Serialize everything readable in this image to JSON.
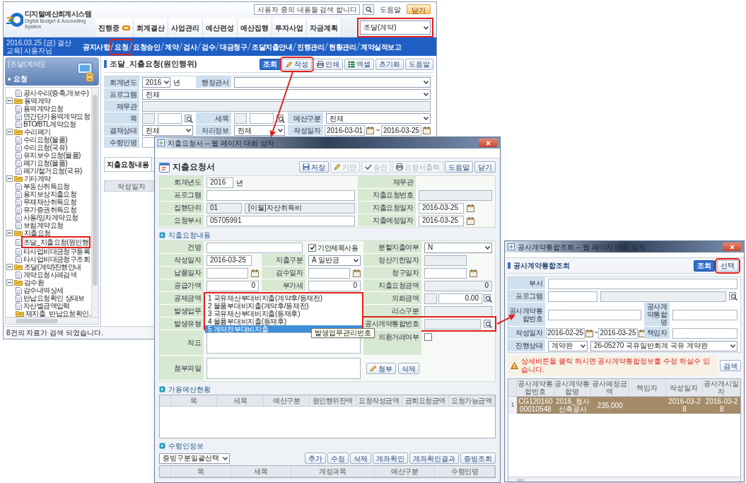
{
  "main_window": {
    "logo": {
      "name": "디지털예산회계시스템",
      "tagline": "Digital Budget & Accounting System"
    },
    "search": {
      "placeholder": "사용자 중의 내용을 검색 합니다"
    },
    "links": [
      {
        "label": "도움말",
        "kind": "link"
      },
      {
        "label": "닫기",
        "kind": "button"
      }
    ],
    "top_menu": [
      {
        "label": "진행중",
        "badge": true
      },
      {
        "label": "회계결산",
        "badge": false
      },
      {
        "label": "사업관리",
        "badge": false
      },
      {
        "label": "예산편성",
        "badge": false
      },
      {
        "label": "예산집행",
        "badge": false
      },
      {
        "label": "투자사업",
        "badge": false
      },
      {
        "label": "자금계획",
        "badge": false
      }
    ],
    "work_select": {
      "value": "조달(계약)",
      "highlighted": true
    },
    "user_info": "2016.03.25 (금) 결산교육| 사용자님",
    "sub_menu": [
      {
        "label": "공지사항",
        "selected": false
      },
      {
        "label": "요청",
        "selected": true
      },
      {
        "label": "요청승인",
        "selected": false
      },
      {
        "label": "계약",
        "selected": false
      },
      {
        "label": "검사",
        "selected": false
      },
      {
        "label": "검수",
        "selected": false
      },
      {
        "label": "대금청구",
        "selected": false
      },
      {
        "label": "조달지출안내",
        "selected": false
      },
      {
        "label": "진행관리",
        "selected": false
      },
      {
        "label": "현황관리",
        "selected": false
      },
      {
        "label": "계약실적보고",
        "selected": false
      }
    ],
    "sidebar": {
      "category": "[조달(계약)]",
      "section": "요청",
      "tree": [
        {
          "label": "공사수리(증축,개보수)",
          "kind": "doc",
          "selected": false
        },
        {
          "label": "용역계약",
          "kind": "folder",
          "selected": false,
          "children": [
            {
              "label": "용역계약요청",
              "kind": "doc",
              "selected": false
            },
            {
              "label": "연간단가용역계약요청",
              "kind": "doc",
              "selected": false
            },
            {
              "label": "BTO/BTL계약요청",
              "kind": "doc",
              "selected": false
            }
          ]
        },
        {
          "label": "수리폐기",
          "kind": "folder",
          "selected": false,
          "children": [
            {
              "label": "수리요청(물품)",
              "kind": "doc",
              "selected": false
            },
            {
              "label": "수리요청(국유)",
              "kind": "doc",
              "selected": false
            },
            {
              "label": "유지보수요청(물품)",
              "kind": "doc",
              "selected": false
            },
            {
              "label": "폐기요청(물품)",
              "kind": "doc",
              "selected": false
            },
            {
              "label": "폐기/철거요청(국유)",
              "kind": "doc",
              "selected": false
            }
          ]
        },
        {
          "label": "기타계약",
          "kind": "folder",
          "selected": false,
          "children": [
            {
              "label": "부동산취득요청",
              "kind": "doc",
              "selected": false
            },
            {
              "label": "용지보상지출요청",
              "kind": "doc",
              "selected": false
            },
            {
              "label": "무체재산취득요청",
              "kind": "doc",
              "selected": false
            },
            {
              "label": "유가증권취득요청",
              "kind": "doc",
              "selected": false
            },
            {
              "label": "사용/임차계약요청",
              "kind": "doc",
              "selected": false
            },
            {
              "label": "보험계약요청",
              "kind": "doc",
              "selected": false
            }
          ]
        },
        {
          "label": "지출요청",
          "kind": "folder",
          "selected": false,
          "children": [
            {
              "label": "조달_지출요청(원인행",
              "kind": "doc",
              "selected": true
            },
            {
              "label": "타사업비대금청구등록",
              "kind": "doc",
              "selected": false
            },
            {
              "label": "타사업비대금청구조회",
              "kind": "doc",
              "selected": false
            }
          ]
        },
        {
          "label": "조달(계약)진행안내",
          "kind": "folder",
          "selected": false,
          "children": [
            {
              "label": "계약요청사례검색",
              "kind": "doc",
              "selected": false
            }
          ]
        },
        {
          "label": "검수환",
          "kind": "folder",
          "selected": false,
          "children": [
            {
              "label": "검수내역상세",
              "kind": "doc",
              "selected": false
            },
            {
              "label": "반납요청확인 상태보",
              "kind": "doc",
              "selected": false
            },
            {
              "label": "자산별금액입력",
              "kind": "doc",
              "selected": false
            },
            {
              "label": "재지출_반납요청확인..",
              "kind": "group",
              "selected": false
            }
          ]
        }
      ]
    },
    "status": "8건의 자료가 검색 되었습니다.",
    "page_title": "조달_지출요청(원인행위)",
    "toolbar": [
      {
        "label": "조회",
        "kind": "primary",
        "highlighted": false
      },
      {
        "label": "작성",
        "kind": "write",
        "highlighted": true
      },
      {
        "label": "인쇄",
        "kind": "print",
        "highlighted": false
      },
      {
        "label": "엑셀",
        "kind": "excel",
        "highlighted": false
      },
      {
        "label": "초기화",
        "kind": "plain",
        "highlighted": false
      },
      {
        "label": "도움말",
        "kind": "plain",
        "highlighted": false
      }
    ],
    "search_form": {
      "fiscal_year": {
        "label": "회계년도",
        "value": "2016",
        "unit": "년"
      },
      "office": {
        "label": "행정관서"
      },
      "program": {
        "label": "프로그램",
        "value": "전체"
      },
      "officer": {
        "label": "재무관"
      },
      "item": {
        "label": "목"
      },
      "sub_item": {
        "label": "세목"
      },
      "budget_type": {
        "label": "예산구분",
        "value": "전체"
      },
      "approval": {
        "label": "결재상태",
        "value": "전체"
      },
      "process": {
        "label": "처리정보",
        "value": "전체"
      },
      "date": {
        "label": "작성일자",
        "from": "2016-03-01",
        "separator": "~",
        "to": "2016-03-25"
      },
      "payee": {
        "label": "수령인명"
      }
    },
    "tabs": [
      {
        "label": "지출요청내용",
        "selected": true
      }
    ],
    "grid_columns": [
      "작성일자"
    ]
  },
  "request_dialog": {
    "title": "지출요청서 -- 웹 페이지 대화 상자",
    "heading": "지출요청서",
    "buttons": [
      {
        "label": "저장",
        "kind": "save",
        "enabled": true
      },
      {
        "label": "기안",
        "kind": "write",
        "enabled": false
      },
      {
        "label": "승인",
        "kind": "approve",
        "enabled": false
      },
      {
        "label": "요청서출력",
        "kind": "print",
        "enabled": false
      },
      {
        "label": "도움말",
        "kind": "plain",
        "enabled": true
      },
      {
        "label": "닫기",
        "kind": "plain",
        "enabled": true
      }
    ],
    "fiscal_year": {
      "label": "회계년도",
      "value": "2016",
      "unit": "년"
    },
    "officer": {
      "label": "재무관"
    },
    "program": {
      "label": "프로그램"
    },
    "request_no": {
      "label": "지출요청번호"
    },
    "exec_unit": {
      "label": "집행단위",
      "code": "01",
      "name": "[이월]자산취득비"
    },
    "request_date": {
      "label": "지출요청일자",
      "value": "2016-03-25"
    },
    "department": {
      "label": "요청부서",
      "value": "05705991"
    },
    "planned_date": {
      "label": "지출예정일자",
      "value": "2016-03-25"
    },
    "content_section": "지출요청내용",
    "subject": {
      "label": "건명",
      "option": "기안제목사용",
      "checked": true
    },
    "split": {
      "label": "분할지출여부",
      "value": "N"
    },
    "written": {
      "label": "작성일자",
      "value": "2016-03-25"
    },
    "pay_kind": {
      "label": "지출구분",
      "value": "A 일반금"
    },
    "settle": {
      "label": "정산기한일자"
    },
    "delivery": {
      "label": "납품일자"
    },
    "inspection": {
      "label": "검수일자"
    },
    "claim": {
      "label": "청구일자"
    },
    "supply": {
      "label": "공급가액",
      "value": "0"
    },
    "vat": {
      "label": "부가세",
      "value": "0"
    },
    "amount": {
      "label": "지출요청금액",
      "value": "0"
    },
    "deduction": {
      "label": "공제금액"
    },
    "business": {
      "label": "발생업무"
    },
    "occur_type": {
      "label": "발생유형"
    },
    "type_list": {
      "highlighted": true,
      "options": [
        {
          "label": "1 국유재산부대비지출(계약후/등재전)",
          "selected": false
        },
        {
          "label": "2 물품부대비지출(계약후/등재전)",
          "selected": false
        },
        {
          "label": "3 국유재산부대비지출(등재후)",
          "selected": false
        },
        {
          "label": "4 물품부대비지출(등재후)",
          "selected": false
        },
        {
          "label": "5 계약전부대비지출",
          "selected": true
        }
      ]
    },
    "foreign": {
      "label": "외화금액",
      "value": "0.00"
    },
    "lease": {
      "label": "리스구분"
    },
    "contract_no": {
      "label": "공사계약통합번호",
      "highlighted": true
    },
    "tooltip": "발생업무관리번호",
    "memo": {
      "label": "적요"
    },
    "fx": {
      "label": "외환거래여부",
      "checked": false
    },
    "attach": {
      "label": "첨부파일",
      "buttons": [
        "첨부",
        "삭제"
      ]
    },
    "budget_section": {
      "title": "가용예산현황",
      "columns": [
        "목",
        "세목",
        "예산구분",
        "원인행위잔액",
        "요청작성금액",
        "금회요청금액",
        "요청가능금액"
      ]
    },
    "payee_section": {
      "title": "수령인정보",
      "select": "증빙구분일괄선택",
      "buttons": [
        "추가",
        "수정",
        "삭제",
        "계좌확인",
        "계좌확인결과",
        "증빙조회"
      ],
      "columns": [
        "목",
        "세목",
        "계정과목",
        "예산구분",
        "수령인명"
      ]
    }
  },
  "contract_dialog": {
    "title": "공사계약통합조회 -- 웹 페이지 대화 상자",
    "heading": "공사계약통합조회",
    "buttons": [
      {
        "label": "조회",
        "kind": "primary",
        "highlighted": false
      },
      {
        "label": "선택",
        "kind": "plain",
        "highlighted": true
      }
    ],
    "department": {
      "label": "부서"
    },
    "program": {
      "label": "프로그램"
    },
    "contract_no": {
      "label": "공사계약통합번호"
    },
    "contract_name": {
      "label": "공사계약통합 명"
    },
    "date": {
      "label": "작성일자",
      "from": "2016-02-25",
      "separator": "~",
      "to": "2016-03-25"
    },
    "manager": {
      "label": "책임자"
    },
    "status": {
      "label": "진행상태",
      "value": "계약완",
      "detail": "26-05270 국유일반회계 국유 계약완"
    },
    "notice": "상세버튼을 클릭 하시면 공사계약통합정보를 수정 하실수 있습니다.",
    "search_button": "검색",
    "columns": [
      "공사계약통합번호",
      "공사계약통합명",
      "공사예정금액",
      "책임자",
      "작성일자",
      "공사개시일자"
    ],
    "rows": [
      {
        "number": "1",
        "cells": [
          "CG12016000010548",
          "2016_청사신축공사",
          "235,000",
          "",
          "2016-03-28",
          "2016-03-28"
        ],
        "selected": true
      }
    ]
  }
}
